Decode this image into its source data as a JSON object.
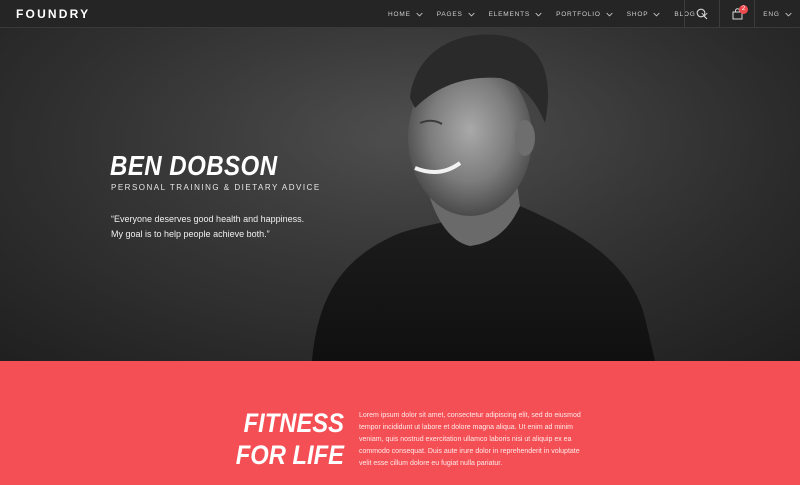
{
  "brand": {
    "logo": "FOUNDRY"
  },
  "nav": {
    "items": [
      {
        "label": "HOME"
      },
      {
        "label": "PAGES"
      },
      {
        "label": "ELEMENTS"
      },
      {
        "label": "PORTFOLIO"
      },
      {
        "label": "SHOP"
      },
      {
        "label": "BLOG"
      }
    ],
    "cart_count": "2",
    "language": "ENG"
  },
  "hero": {
    "title": "BEN DOBSON",
    "subtitle": "PERSONAL TRAINING & DIETARY ADVICE",
    "quote_line1": "“Everyone deserves good health and happiness.",
    "quote_line2": "My goal is to help people achieve both.”"
  },
  "band": {
    "title_line1": "FITNESS",
    "title_line2": "FOR LIFE",
    "text": "Lorem ipsum dolor sit amet, consectetur adipiscing elit, sed do eiusmod tempor incididunt ut labore et dolore magna aliqua. Ut enim ad minim veniam, quis nostrud exercitation ullamco laboris nisi ut aliquip ex ea commodo consequat. Duis aute irure dolor in reprehenderit in voluptate velit esse cillum dolore eu fugiat nulla pariatur."
  },
  "colors": {
    "accent": "#f44f54",
    "nav_bg": "#252525"
  },
  "icons": [
    "search-icon",
    "cart-icon",
    "chevron-down-icon"
  ]
}
